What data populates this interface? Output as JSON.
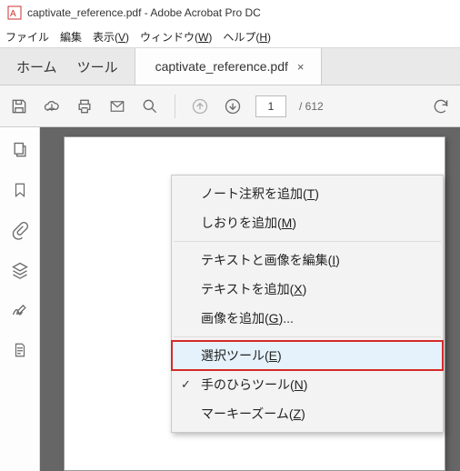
{
  "title": {
    "text": "captivate_reference.pdf - Adobe Acrobat Pro DC"
  },
  "menubar": {
    "file": "ファイル",
    "edit": "編集",
    "view_pre": "表示(",
    "view_u": "V",
    "view_post": ")",
    "window_pre": "ウィンドウ(",
    "window_u": "W",
    "window_post": ")",
    "help_pre": "ヘルプ(",
    "help_u": "H",
    "help_post": ")"
  },
  "tabs": {
    "home": "ホーム",
    "tools": "ツール",
    "docname": "captivate_reference.pdf",
    "close": "×"
  },
  "toolbar": {
    "page_current": "1",
    "page_total": "/  612"
  },
  "context": {
    "addnote_pre": "ノート注釈を追加(",
    "addnote_u": "T",
    "addnote_post": ")",
    "addbm_pre": "しおりを追加(",
    "addbm_u": "M",
    "addbm_post": ")",
    "edit_ti_pre": "テキストと画像を編集(",
    "edit_ti_u": "I",
    "edit_ti_post": ")",
    "addtext_pre": "テキストを追加(",
    "addtext_u": "X",
    "addtext_post": ")",
    "addimg_pre": "画像を追加(",
    "addimg_u": "G",
    "addimg_post": ")...",
    "seltool_pre": "選択ツール(",
    "seltool_u": "E",
    "seltool_post": ")",
    "handtool_pre": "手のひらツール(",
    "handtool_u": "N",
    "handtool_post": ")",
    "marquee_pre": "マーキーズーム(",
    "marquee_u": "Z",
    "marquee_post": ")",
    "check": "✓"
  }
}
